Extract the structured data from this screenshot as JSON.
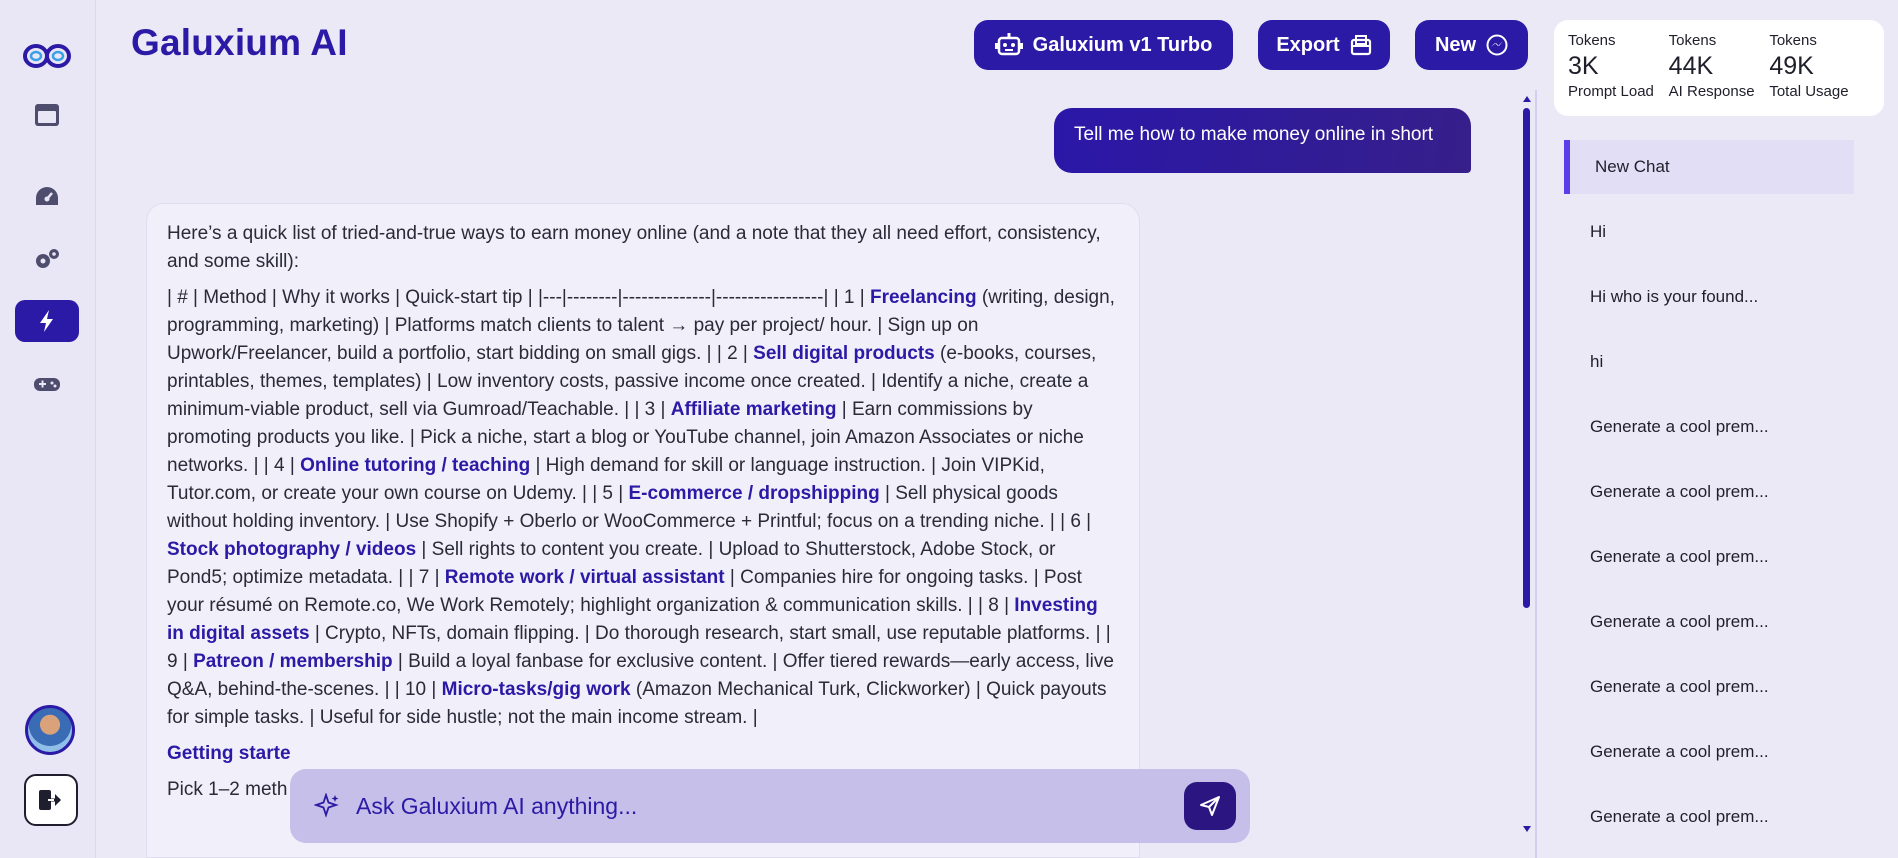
{
  "app": {
    "brand": "Galuxium AI"
  },
  "header": {
    "model_label": "Galuxium v1 Turbo",
    "export_label": "Export",
    "new_label": "New"
  },
  "sidebar": {
    "icons": [
      "infinity-logo-icon",
      "window-icon",
      "dashboard-gauge-icon",
      "settings-gears-icon",
      "lightning-icon",
      "gamepad-icon"
    ],
    "active": "lightning-icon"
  },
  "tokens": [
    {
      "label": "Tokens",
      "value": "3K",
      "sub": "Prompt Load"
    },
    {
      "label": "Tokens",
      "value": "44K",
      "sub": "AI Response"
    },
    {
      "label": "Tokens",
      "value": "49K",
      "sub": "Total Usage"
    }
  ],
  "history": [
    "New Chat",
    "Hi",
    "Hi who is your found...",
    "hi",
    "Generate a cool prem...",
    "Generate a cool prem...",
    "Generate a cool prem...",
    "Generate a cool prem...",
    "Generate a cool prem...",
    "Generate a cool prem...",
    "Generate a cool prem..."
  ],
  "chat": {
    "user_message": "Tell me how to make money online in short",
    "ai_intro": "Here’s a quick list of tried-and-true ways to earn money online (and a note that they all need effort, consistency, and some skill):",
    "ai_table_head": "| # | Method | Why it works | Quick-start tip | |---|--------|--------------|-----------------| | 1 | ",
    "rows": [
      {
        "num": "1",
        "method": "Freelancing",
        "after": " (writing, design, programming, marketing) | Platforms match clients to talent → pay per project/ hour. | Sign up on Upwork/Freelancer, build a portfolio, start bidding on small gigs. | | 2 | "
      },
      {
        "num": "2",
        "method": "Sell digital products",
        "after": " (e-books, courses, printables, themes, templates) | Low inventory costs, passive income once created. | Identify a niche, create a minimum-viable product, sell via Gumroad/Teachable. | | 3 | "
      },
      {
        "num": "3",
        "method": "Affiliate marketing",
        "after": " | Earn commissions by promoting products you like. | Pick a niche, start a blog or YouTube channel, join Amazon Associates or niche networks. | | 4 | "
      },
      {
        "num": "4",
        "method": "Online tutoring / teaching",
        "after": " | High demand for skill or language instruction. | Join VIPKid, Tutor.com, or create your own course on Udemy. | | 5 | "
      },
      {
        "num": "5",
        "method": "E-commerce / dropshipping",
        "after": " | Sell physical goods without holding inventory. | Use Shopify + Oberlo or WooCommerce + Printful; focus on a trending niche. | | 6 | "
      },
      {
        "num": "6",
        "method": "Stock photography / videos",
        "after": " | Sell rights to content you create. | Upload to Shutterstock, Adobe Stock, or Pond5; optimize metadata. | | 7 | "
      },
      {
        "num": "7",
        "method": "Remote work / virtual assistant",
        "after": " | Companies hire for ongoing tasks. | Post your résumé on Remote.co, We Work Remotely; highlight organization & communication skills. | | 8 | "
      },
      {
        "num": "8",
        "method": "Investing in digital assets",
        "after": " | Crypto, NFTs, domain flipping. | Do thorough research, start small, use reputable platforms. | | 9 | "
      },
      {
        "num": "9",
        "method": "Patreon / membership",
        "after": " | Build a loyal fanbase for exclusive content. | Offer tiered rewards—early access, live Q&A, behind-the-scenes. | | 10 | "
      },
      {
        "num": "10",
        "method": "Micro-tasks/gig work",
        "after": " (Amazon Mechanical Turk, Clickworker) | Quick payouts for simple tasks. | Useful for side hustle; not the main income stream. |"
      }
    ],
    "getting_started": "Getting starte",
    "pick_text": "Pick 1–2 meth"
  },
  "composer": {
    "placeholder": "Ask Galuxium AI anything..."
  },
  "colors": {
    "accent": "#2b1aa5",
    "background": "#ece9f7",
    "composer": "#c6bfea"
  }
}
